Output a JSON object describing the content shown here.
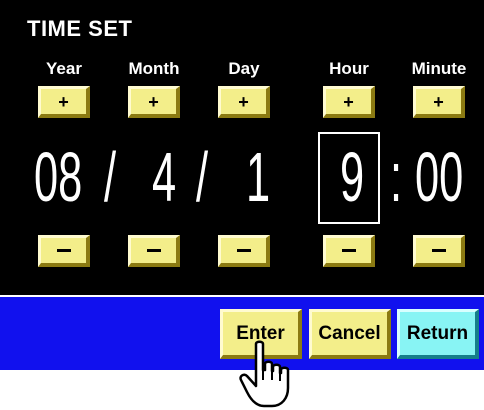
{
  "title": "TIME SET",
  "columns": [
    {
      "label": "Year",
      "plus": "+",
      "minus": "−"
    },
    {
      "label": "Month",
      "plus": "+",
      "minus": "−"
    },
    {
      "label": "Day",
      "plus": "+",
      "minus": "−"
    },
    {
      "label": "Hour",
      "plus": "+",
      "minus": "−"
    },
    {
      "label": "Minute",
      "plus": "+",
      "minus": "−"
    }
  ],
  "display": {
    "year": "08",
    "sep1": "/",
    "month": "4",
    "sep2": "/",
    "day": "1",
    "hour": "9",
    "colon": ":",
    "minute": "00"
  },
  "actions": {
    "enter": "Enter",
    "cancel": "Cancel",
    "return": "Return"
  },
  "colors": {
    "panel": "#000000",
    "button_yellow": "#f3ee8a",
    "button_cyan": "#88f4f4",
    "action_bar": "#1111ee"
  },
  "icons": {
    "pointer": "hand-pointer-icon"
  }
}
